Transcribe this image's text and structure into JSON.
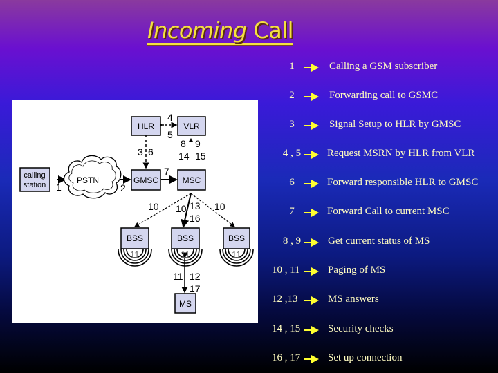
{
  "title": {
    "word1": "Incoming",
    "word2": "Call"
  },
  "diagram": {
    "nodes": {
      "calling_station": [
        "calling",
        "station"
      ],
      "pstn": "PSTN",
      "hlr": "HLR",
      "vlr": "VLR",
      "gmsc": "GMSC",
      "msc": "MSC",
      "bss_left": "BSS",
      "bss_mid": "BSS",
      "bss_right": "BSS",
      "ms": "MS"
    },
    "labels": {
      "l1": "1",
      "l2": "2",
      "l3": "3",
      "l4": "4",
      "l5": "5",
      "l6": "6",
      "l7": "7",
      "l8": "8",
      "l9": "9",
      "l14": "14",
      "l15": "15",
      "l10a": "10",
      "l10b": "10",
      "l13": "13",
      "l16": "16",
      "l10c": "10",
      "l11a": "11",
      "l11b": "11",
      "l11c": "11",
      "l11d": "11",
      "l12": "12",
      "l17": "17"
    }
  },
  "colors": {
    "legend_text": "#fffcc0",
    "arrow": "#ffff30",
    "title": "#f4e040"
  },
  "legend": [
    {
      "num": "1",
      "desc": "Calling a GSM subscriber"
    },
    {
      "num": "2",
      "desc": "Forwarding call to GSMC"
    },
    {
      "num": "3",
      "desc": "Signal Setup to HLR by GMSC"
    },
    {
      "num": "4 , 5",
      "desc": "Request MSRN by HLR from VLR"
    },
    {
      "num": "6",
      "desc": "Forward responsible HLR to GMSC"
    },
    {
      "num": "7",
      "desc": "Forward Call to current MSC"
    },
    {
      "num": "8 , 9",
      "desc": "Get current status of MS"
    },
    {
      "num": "10 , 11",
      "desc": "Paging of MS"
    },
    {
      "num": "12 ,13",
      "desc": "MS answers"
    },
    {
      "num": "14 , 15",
      "desc": "Security checks"
    },
    {
      "num": "16 , 17",
      "desc": "Set up connection"
    }
  ]
}
